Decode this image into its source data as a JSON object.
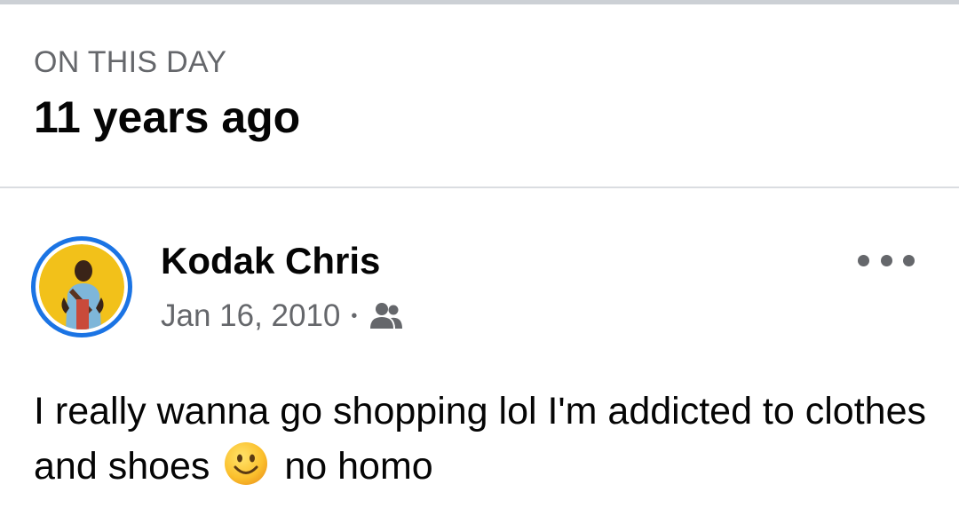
{
  "memory": {
    "eyebrow": "ON THIS DAY",
    "headline": "11 years ago"
  },
  "post": {
    "author": "Kodak Chris",
    "date": "Jan 16, 2010",
    "separator": "•",
    "audience_icon": "friends-icon",
    "more_icon": "more-options-icon",
    "text_before_emoji": "I really wanna go shopping lol I'm addicted to clothes and shoes",
    "emoji": "smiling-face-emoji",
    "text_after_emoji": "no homo"
  },
  "colors": {
    "primary_text": "#050505",
    "secondary_text": "#65676b",
    "avatar_ring": "#1b74e4",
    "divider": "#dadde1",
    "avatar_background": "#f5c518"
  }
}
